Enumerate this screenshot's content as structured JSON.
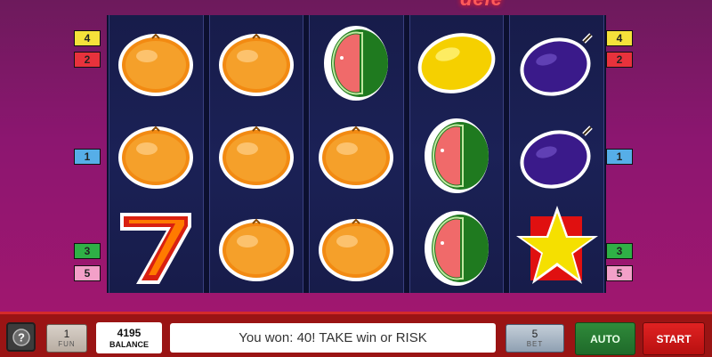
{
  "logo": {
    "text": "dele"
  },
  "reels": [
    [
      "orange",
      "orange",
      "seven"
    ],
    [
      "orange",
      "orange",
      "orange"
    ],
    [
      "watermelon",
      "orange",
      "orange"
    ],
    [
      "lemon",
      "watermelon",
      "watermelon"
    ],
    [
      "plum",
      "plum",
      "star"
    ]
  ],
  "line_indicators": {
    "left": [
      {
        "label": "4",
        "color": "yellow"
      },
      {
        "label": "2",
        "color": "red"
      },
      {
        "label": "1",
        "color": "blue"
      },
      {
        "label": "3",
        "color": "green"
      },
      {
        "label": "5",
        "color": "pink"
      }
    ],
    "right": [
      {
        "label": "4",
        "color": "yellow"
      },
      {
        "label": "2",
        "color": "red"
      },
      {
        "label": "1",
        "color": "blue"
      },
      {
        "label": "3",
        "color": "green"
      },
      {
        "label": "5",
        "color": "pink"
      }
    ]
  },
  "panel": {
    "help_label": "?",
    "bet": {
      "value": "1",
      "label": "FUN"
    },
    "balance": {
      "value": "4195",
      "label": "BALANCE"
    },
    "message": "You won: 40! TAKE win or RISK",
    "lines": {
      "value": "5",
      "label": "BET"
    },
    "auto_label": "AUTO",
    "start_label": "START"
  },
  "colors": {
    "accent_red": "#e02222",
    "auto_green": "#2f8a3a",
    "reel_bg": "#1b2156"
  }
}
